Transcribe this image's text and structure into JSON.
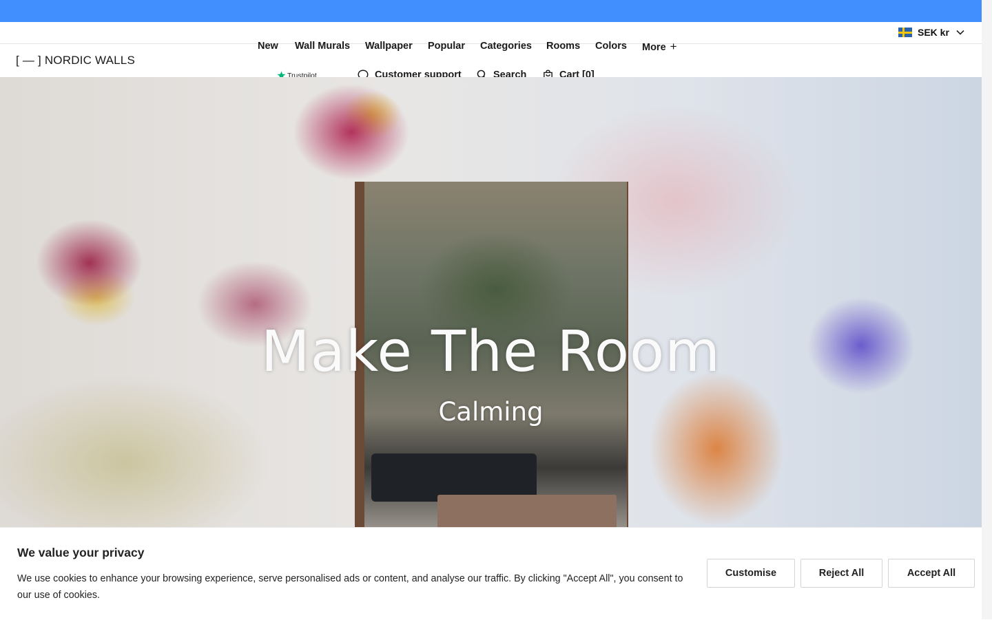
{
  "brand": {
    "logo": "[ — ] NORDIC WALLS"
  },
  "nav": [
    {
      "label": "New"
    },
    {
      "label": "Wall Murals"
    },
    {
      "label": "Wallpaper"
    },
    {
      "label": "Popular"
    },
    {
      "label": "Categories"
    },
    {
      "label": "Rooms"
    },
    {
      "label": "Colors"
    },
    {
      "label": "More"
    }
  ],
  "trustpilot": {
    "label": "Trustpilot"
  },
  "utility": {
    "support": "Customer support",
    "search": "Search",
    "cart": "Cart [0]"
  },
  "currency": {
    "value": "SEK kr",
    "flag": "sweden-flag-icon"
  },
  "hero": {
    "headline": "Make The Room",
    "subline": "Calming"
  },
  "cookie_banner": {
    "title": "We value your privacy",
    "text": "We use cookies to enhance your browsing experience, serve personalised ads or content, and analyse our traffic. By clicking \"Accept All\", you consent to our use of cookies.",
    "customise": "Customise",
    "reject": "Reject All",
    "accept": "Accept All"
  },
  "colors": {
    "top_bar": "#418ffe",
    "trustpilot_star": "#00b67a"
  }
}
